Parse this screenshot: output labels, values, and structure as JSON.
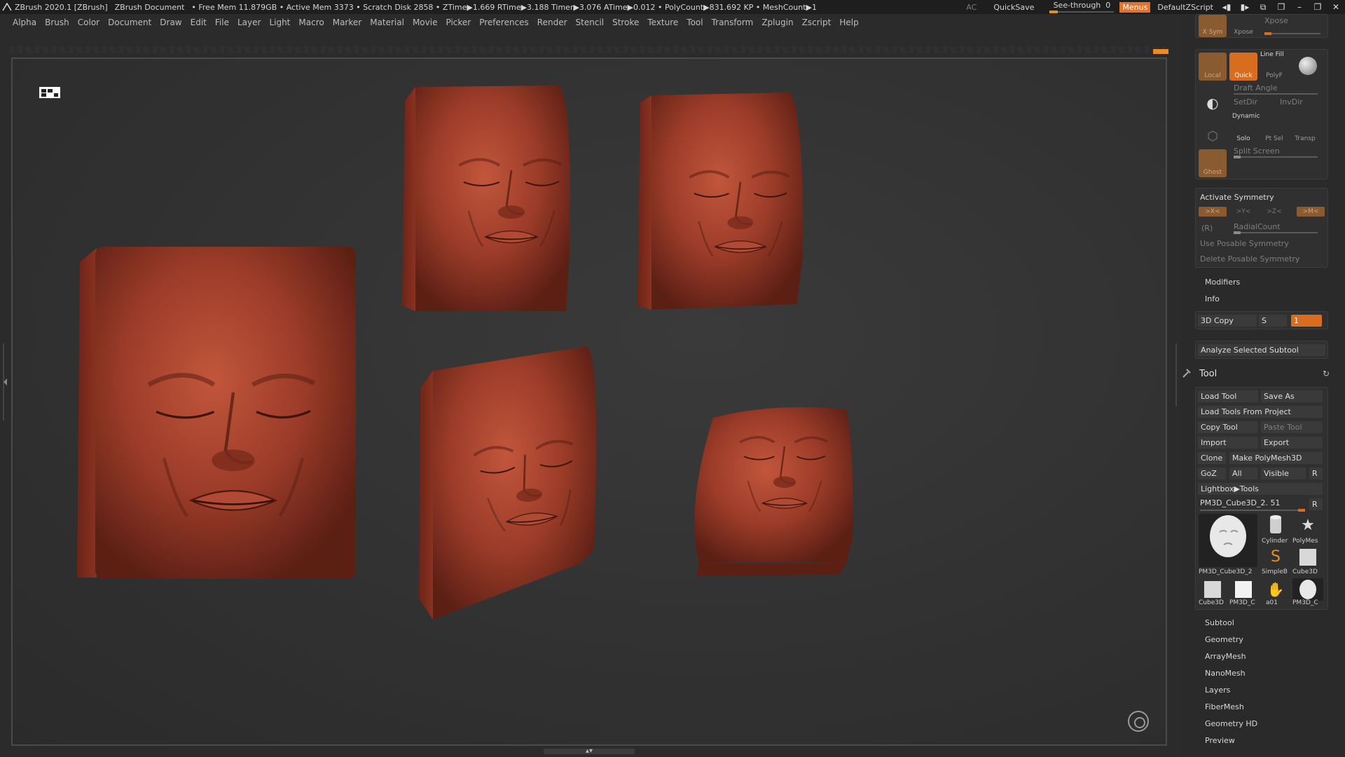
{
  "titlebar": {
    "app": "ZBrush 2020.1 [ZBrush]",
    "document": "ZBrush Document",
    "stats": "• Free Mem 11.879GB • Active Mem 3373 • Scratch Disk 2858 •  ZTime▶1.669 RTime▶3.188 Timer▶3.076 ATime▶0.012 • PolyCount▶831.692 KP • MeshCount▶1",
    "ac": "AC",
    "quicksave": "QuickSave",
    "see_through_label": "See-through",
    "see_through_value": "0",
    "menus": "Menus",
    "script": "DefaultZScript"
  },
  "menubar": [
    "Alpha",
    "Brush",
    "Color",
    "Document",
    "Draw",
    "Edit",
    "File",
    "Layer",
    "Light",
    "Macro",
    "Marker",
    "Material",
    "Movie",
    "Picker",
    "Preferences",
    "Render",
    "Stencil",
    "Stroke",
    "Texture",
    "Tool",
    "Transform",
    "Zplugin",
    "Zscript",
    "Help"
  ],
  "right_panel": {
    "xpose": {
      "sym": "X Sym",
      "xpose_label": "Xpose",
      "xpose_btn": "Xpose"
    },
    "render": {
      "local": "Local",
      "quick": "Quick",
      "line_fill": "Line Fill",
      "polyf": "PolyF",
      "draft_angle": "Draft Angle",
      "setdir": "SetDir",
      "invdir": "InvDir",
      "dynamic": "Dynamic",
      "solo": "Solo",
      "ptsel": "Pt Sel",
      "transp": "Transp",
      "ghost": "Ghost",
      "split_screen": "Split Screen"
    },
    "symmetry": {
      "activate": "Activate Symmetry",
      "x": ">X<",
      "y": ">Y<",
      "z": ">Z<",
      "m": ">M<",
      "r": "(R)",
      "radial": "RadialCount",
      "use_posable": "Use Posable Symmetry",
      "delete_posable": "Delete Posable Symmetry"
    },
    "modifiers": "Modifiers",
    "info": "Info",
    "copy3d": {
      "label": "3D Copy",
      "s": "S",
      "value": "1"
    },
    "analyze": "Analyze Selected Subtool",
    "tool": {
      "title": "Tool",
      "load": "Load Tool",
      "save_as": "Save As",
      "load_project": "Load Tools From Project",
      "copy": "Copy Tool",
      "paste": "Paste Tool",
      "import": "Import",
      "export": "Export",
      "clone": "Clone",
      "make_polymesh": "Make PolyMesh3D",
      "goz": "GoZ",
      "all": "All",
      "visible": "Visible",
      "r": "R",
      "lightbox": "Lightbox▶Tools",
      "current": "PM3D_Cube3D_2. 51",
      "current_r": "R",
      "thumbs": [
        "PM3D_Cube3D_2",
        "Cylinder",
        "PolyMes",
        "SimpleB",
        "Cube3D",
        "Cube3D",
        "PM3D_C",
        "a01",
        "PM3D_C"
      ]
    },
    "sections": [
      "Subtool",
      "Geometry",
      "ArrayMesh",
      "NanoMesh",
      "Layers",
      "FiberMesh",
      "Geometry HD",
      "Preview"
    ]
  },
  "colors": {
    "accent": "#e88c2a",
    "clay": "#9a3b28",
    "clay_dark": "#5c1f14",
    "clay_light": "#c05a42"
  }
}
